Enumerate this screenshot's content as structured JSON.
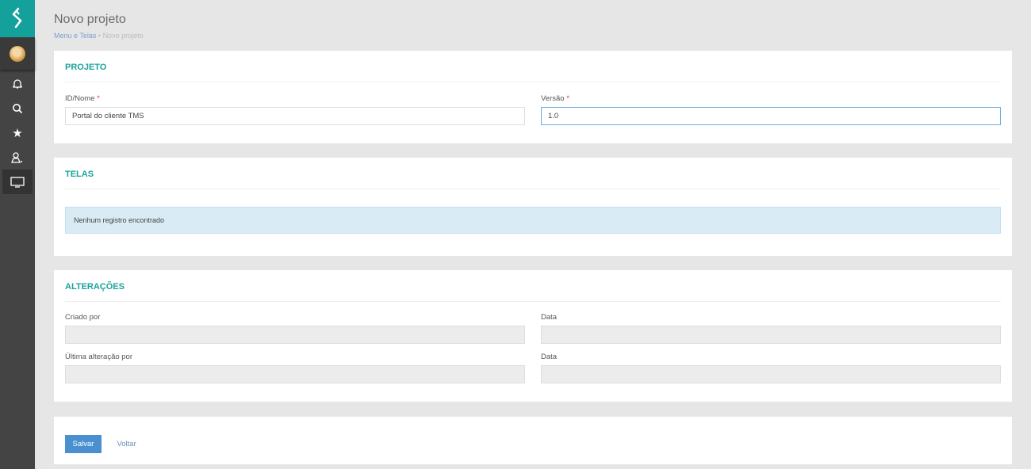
{
  "sidebar": {
    "items": [
      "notifications",
      "search",
      "favorites",
      "users",
      "screens"
    ]
  },
  "header": {
    "title": "Novo projeto",
    "breadcrumb": [
      "Menu e Telas",
      "Novo projeto"
    ]
  },
  "projeto": {
    "heading": "PROJETO",
    "name_label": "ID/Nome",
    "name_value": "Portal do cliente TMS",
    "version_label": "Versão",
    "version_value": "1.0",
    "required": "*"
  },
  "telas": {
    "heading": "TELAS",
    "empty": "Nenhum registro encontrado"
  },
  "alteracoes": {
    "heading": "ALTERAÇÕES",
    "created_by": "Criado por",
    "date1": "Data",
    "modified_by": "Última alteração por",
    "date2": "Data"
  },
  "actions": {
    "save": "Salvar",
    "back": "Voltar"
  },
  "colors": {
    "accent": "#14a19c",
    "primary": "#4a90d0"
  }
}
